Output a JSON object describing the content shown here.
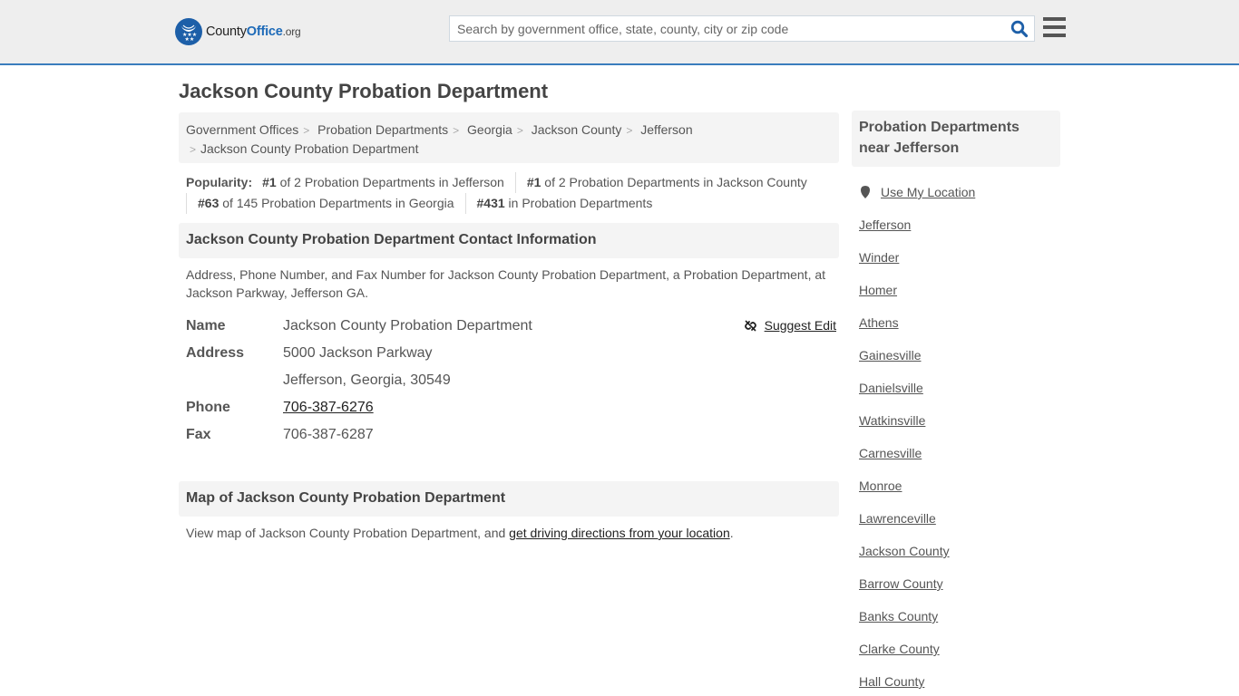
{
  "header": {
    "logo": {
      "name_part1": "County",
      "name_part2": "Office",
      "tld": ".org"
    },
    "search": {
      "placeholder": "Search by government office, state, county, city or zip code",
      "value": ""
    },
    "icons": {
      "search": "search-icon",
      "menu": "hamburger-menu-icon"
    },
    "accent_color": "#3a7dbd"
  },
  "page": {
    "title": "Jackson County Probation Department"
  },
  "breadcrumb": [
    {
      "label": "Government Offices"
    },
    {
      "label": "Probation Departments"
    },
    {
      "label": "Georgia"
    },
    {
      "label": "Jackson County"
    },
    {
      "label": "Jefferson"
    },
    {
      "label": "Jackson County Probation Department"
    }
  ],
  "popularity": {
    "label": "Popularity:",
    "items": [
      {
        "rank": "#1",
        "text": " of 2 Probation Departments in Jefferson"
      },
      {
        "rank": "#1",
        "text": " of 2 Probation Departments in Jackson County"
      },
      {
        "rank": "#63",
        "text": " of 145 Probation Departments in Georgia"
      },
      {
        "rank": "#431",
        "text": " in Probation Departments"
      }
    ]
  },
  "contact": {
    "heading": "Jackson County Probation Department Contact Information",
    "description": "Address, Phone Number, and Fax Number for Jackson County Probation Department, a Probation Department, at Jackson Parkway, Jefferson GA.",
    "suggest_edit": "Suggest Edit",
    "fields": {
      "name_label": "Name",
      "name_value": "Jackson County Probation Department",
      "address_label": "Address",
      "address_line1": "5000 Jackson Parkway",
      "address_line2": "Jefferson, Georgia, 30549",
      "phone_label": "Phone",
      "phone_value": "706-387-6276",
      "fax_label": "Fax",
      "fax_value": "706-387-6287"
    }
  },
  "map": {
    "heading": "Map of Jackson County Probation Department",
    "text_before": "View map of Jackson County Probation Department, and ",
    "link": "get driving directions from your location",
    "text_after": "."
  },
  "sidebar": {
    "heading": "Probation Departments near Jefferson",
    "use_location": "Use My Location",
    "items": [
      {
        "label": "Jefferson"
      },
      {
        "label": "Winder"
      },
      {
        "label": "Homer"
      },
      {
        "label": "Athens"
      },
      {
        "label": "Gainesville"
      },
      {
        "label": "Danielsville"
      },
      {
        "label": "Watkinsville"
      },
      {
        "label": "Carnesville"
      },
      {
        "label": "Monroe"
      },
      {
        "label": "Lawrenceville"
      },
      {
        "label": "Jackson County"
      },
      {
        "label": "Barrow County"
      },
      {
        "label": "Banks County"
      },
      {
        "label": "Clarke County"
      },
      {
        "label": "Hall County"
      }
    ]
  }
}
